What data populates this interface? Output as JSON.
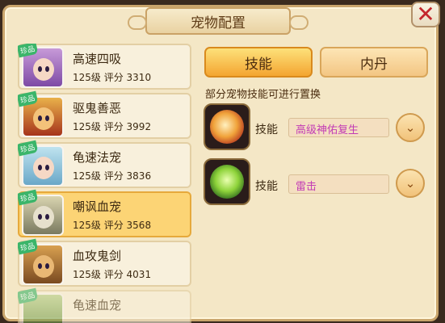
{
  "title": "宠物配置",
  "close_label": "✕",
  "tabs": [
    {
      "label": "技能",
      "active": true
    },
    {
      "label": "内丹",
      "active": false
    }
  ],
  "hint": "部分宠物技能可进行置换",
  "skills": [
    {
      "label": "技能",
      "name": "高级神佑复生"
    },
    {
      "label": "技能",
      "name": "雷击"
    }
  ],
  "pets": [
    {
      "badge": "珍品",
      "name": "高速四吸",
      "level": "125级  评分  3310",
      "selected": false
    },
    {
      "badge": "珍品",
      "name": "驱鬼善恶",
      "level": "125级  评分  3992",
      "selected": false
    },
    {
      "badge": "珍品",
      "name": "龟速法宠",
      "level": "125级  评分  3836",
      "selected": false
    },
    {
      "badge": "珍品",
      "name": "嘲讽血宠",
      "level": "125级  评分  3568",
      "selected": true
    },
    {
      "badge": "珍品",
      "name": "血攻鬼剑",
      "level": "125级  评分  4031",
      "selected": false
    },
    {
      "badge": "珍品",
      "name": "龟速血宠",
      "level": "",
      "selected": false
    }
  ]
}
